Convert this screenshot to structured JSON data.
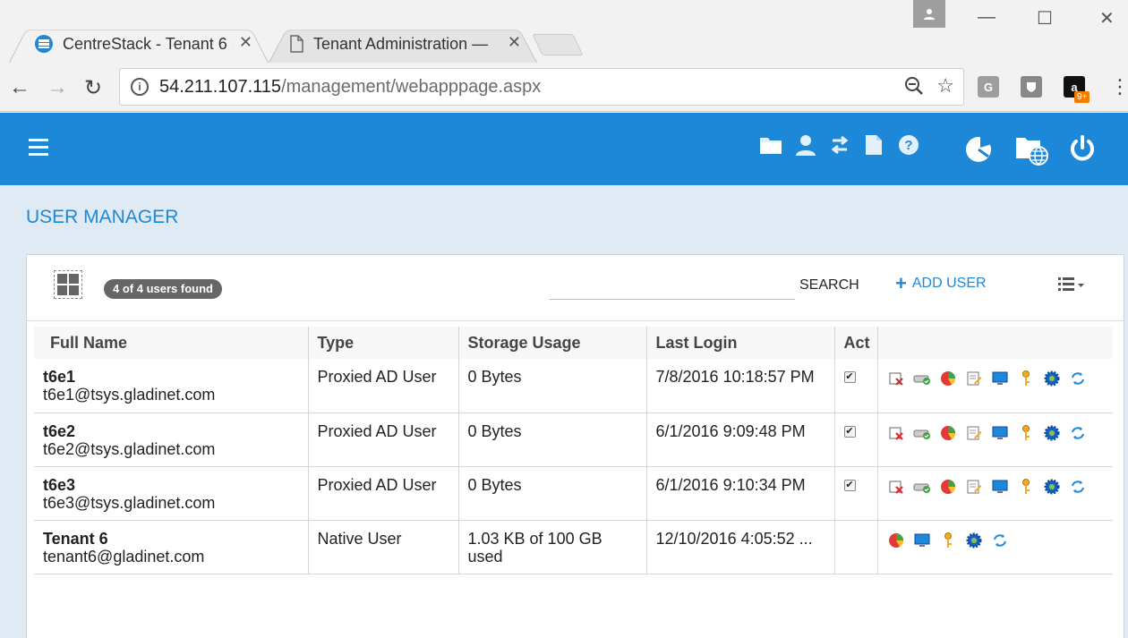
{
  "browser": {
    "tabs": [
      {
        "title": "CentreStack - Tenant 6 (t",
        "active": true
      },
      {
        "title": "Tenant Administration —",
        "active": false
      }
    ],
    "url_host": "54.211.107.115",
    "url_path": "/management/webapppage.aspx",
    "ext_badge": "9+"
  },
  "header": {
    "icons": [
      "folder-icon",
      "user-icon",
      "transfer-icon",
      "document-icon",
      "help-icon",
      "pie-chart-icon",
      "web-folder-icon",
      "power-icon"
    ]
  },
  "page": {
    "title": "USER MANAGER",
    "count_badge": "4 of 4 users found",
    "search_label": "SEARCH",
    "add_user_label": "ADD USER"
  },
  "table": {
    "columns": [
      "Full Name",
      "Type",
      "Storage Usage",
      "Last Login",
      "Act"
    ],
    "rows": [
      {
        "name": "t6e1",
        "email": "t6e1@tsys.gladinet.com",
        "type": "Proxied AD User",
        "storage": "0 Bytes",
        "last_login": "7/8/2016 10:18:57 PM",
        "active": true
      },
      {
        "name": "t6e2",
        "email": "t6e2@tsys.gladinet.com",
        "type": "Proxied AD User",
        "storage": "0 Bytes",
        "last_login": "6/1/2016 9:09:48 PM",
        "active": true
      },
      {
        "name": "t6e3",
        "email": "t6e3@tsys.gladinet.com",
        "type": "Proxied AD User",
        "storage": "0 Bytes",
        "last_login": "6/1/2016 9:10:34 PM",
        "active": true
      },
      {
        "name": "Tenant 6",
        "email": "tenant6@gladinet.com",
        "type": "Native User",
        "storage": "1.03 KB of 100 GB used",
        "last_login": "12/10/2016 4:05:52 ...",
        "active": false
      }
    ]
  },
  "colors": {
    "header_blue": "#1e88d8",
    "content_bg": "#dfeaf5"
  }
}
